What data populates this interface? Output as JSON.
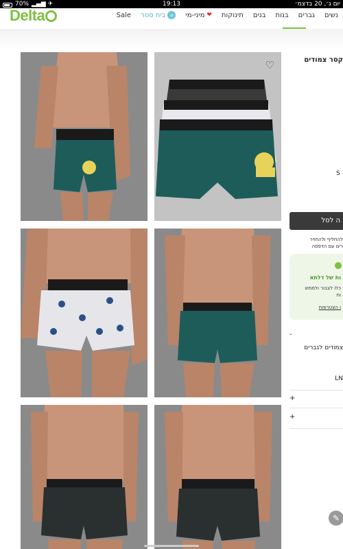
{
  "status_bar": {
    "battery": "70%",
    "time": "19:13",
    "date": "יום ג׳, 20 בדצמ׳"
  },
  "header": {
    "logo": "Delta",
    "nav": [
      {
        "label": "נשים"
      },
      {
        "label": "גברים",
        "active": true
      },
      {
        "label": "בנות"
      },
      {
        "label": "בנים"
      },
      {
        "label": "תינוקות"
      },
      {
        "label": "מיני-מי"
      },
      {
        "label": "בית ססר"
      },
      {
        "label": "Sale"
      }
    ]
  },
  "product": {
    "title_fragment": "קסר צמודים",
    "size_fragment": "S",
    "add_button_fragment": "ה לסל",
    "return_fragment_1": "להחליף ולהחזיר",
    "return_fragment_2": "רים עם הדפסה",
    "promo": {
      "title_fragment": "ות של דלתא",
      "line1_fragment": "כלו לצבור ולממש",
      "line2_fragment": "ות",
      "link_fragment": "ו הצטרפות"
    },
    "accordion_minus": "-",
    "desc_fragment": "צמודים לגברים",
    "code_fragment": "LN",
    "plus_1": "+",
    "plus_2": "+"
  },
  "icons": {
    "favorite": "heart-outline-icon",
    "edit": "pencil-icon"
  },
  "colors": {
    "brand_green": "#7cc142",
    "nav_home_teal": "#5cb8c8",
    "button_dark": "#3a3a3a",
    "promo_bg": "#eef6e8"
  }
}
